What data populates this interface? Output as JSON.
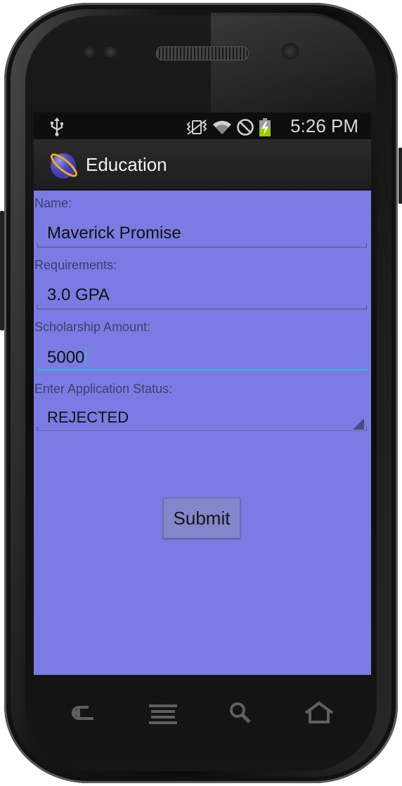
{
  "status_bar": {
    "time": "5:26 PM",
    "icons": [
      "usb-icon",
      "vibrate-icon",
      "wifi-icon",
      "no-signal-icon",
      "battery-charging-icon"
    ]
  },
  "action_bar": {
    "title": "Education",
    "icon": "app-logo-icon"
  },
  "form": {
    "name_label": "Name:",
    "name_value": "Maverick Promise",
    "requirements_label": "Requirements:",
    "requirements_value": "3.0 GPA",
    "amount_label": "Scholarship Amount:",
    "amount_value": "5000",
    "status_label": "Enter Application Status:",
    "status_selected": "REJECTED",
    "submit_label": "Submit"
  },
  "nav_keys": [
    "back-icon",
    "menu-icon",
    "search-icon",
    "home-icon"
  ],
  "colors": {
    "screen_background": "#7b7be3",
    "focus_accent": "#33b5e5",
    "action_bar": "#1d1d1d"
  }
}
